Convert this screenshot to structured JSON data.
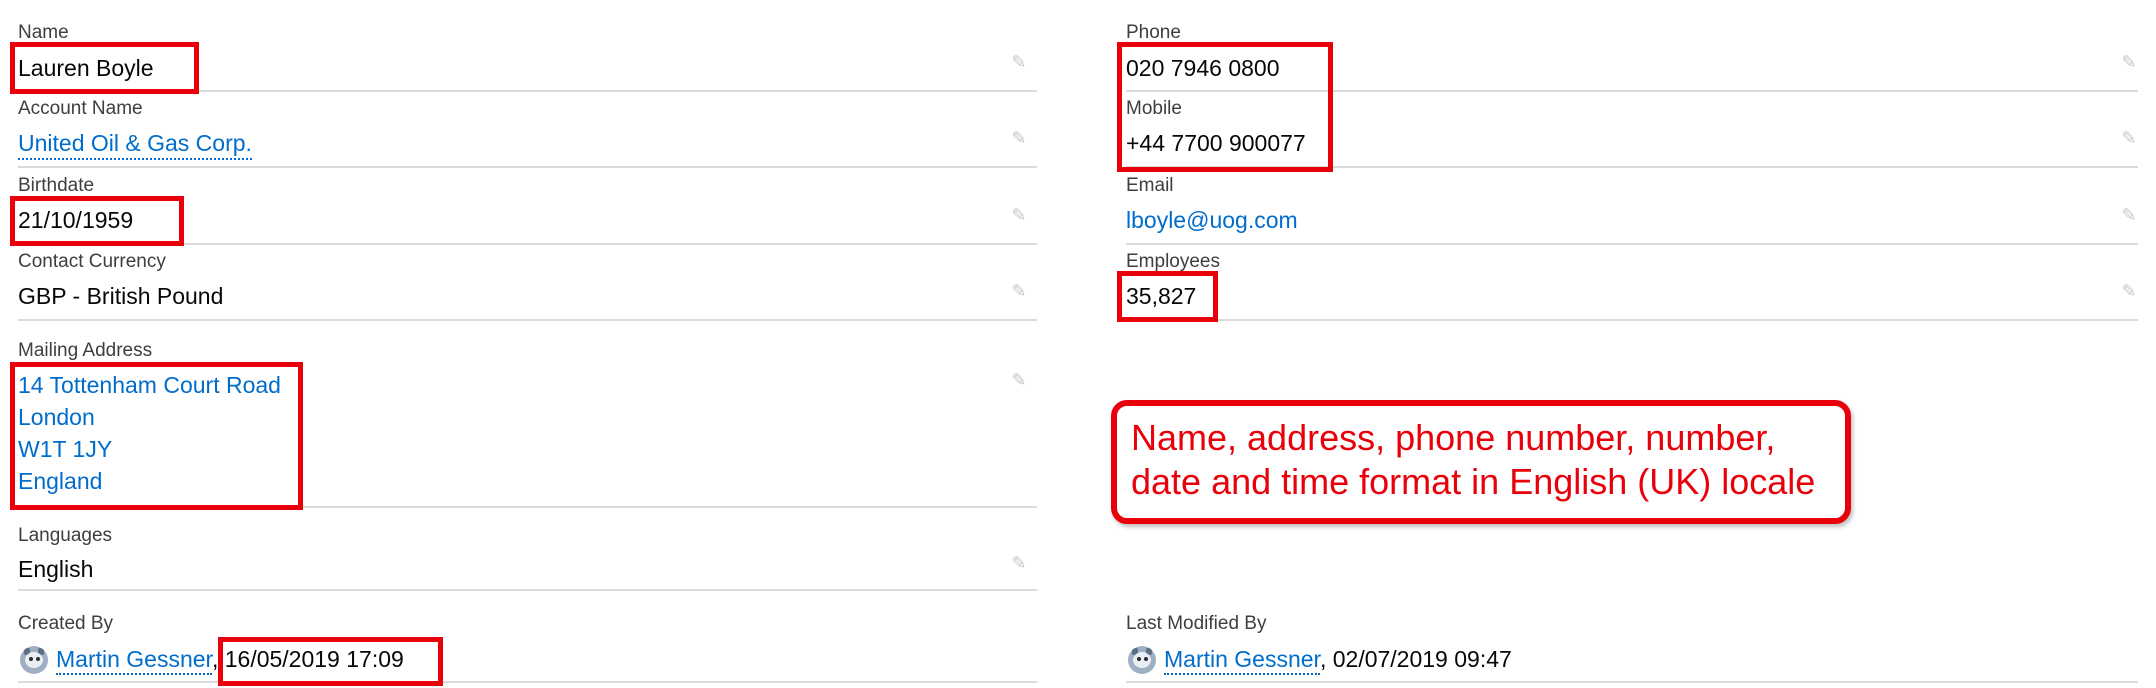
{
  "left_fields": {
    "name": {
      "label": "Name",
      "value": "Lauren Boyle"
    },
    "account_name": {
      "label": "Account Name",
      "value": "United Oil & Gas Corp."
    },
    "birthdate": {
      "label": "Birthdate",
      "value": "21/10/1959"
    },
    "contact_currency": {
      "label": "Contact Currency",
      "value": "GBP - British Pound"
    },
    "mailing_address": {
      "label": "Mailing Address",
      "lines": [
        "14 Tottenham Court Road",
        "London",
        "W1T 1JY",
        "England"
      ]
    },
    "languages": {
      "label": "Languages",
      "value": "English"
    }
  },
  "right_fields": {
    "phone": {
      "label": "Phone",
      "value": "020 7946 0800"
    },
    "mobile": {
      "label": "Mobile",
      "value": "+44 7700 900077"
    },
    "email": {
      "label": "Email",
      "value": "lboyle@uog.com"
    },
    "employees": {
      "label": "Employees",
      "value": "35,827"
    }
  },
  "created_by": {
    "label": "Created By",
    "user": "Martin Gessner",
    "separator": ",",
    "datetime": "16/05/2019 17:09"
  },
  "last_modified_by": {
    "label": "Last Modified By",
    "user": "Martin Gessner",
    "separator": ",",
    "datetime": "02/07/2019 09:47"
  },
  "callout": {
    "line1": "Name, address, phone number, number,",
    "line2": "date and time format in English (UK) locale"
  },
  "icons": {
    "edit": "pencil-icon",
    "user": "avatar-icon"
  },
  "colors": {
    "link": "#006dcc",
    "annotation": "#e8000a",
    "divider": "#dddbda",
    "label": "#3e3e3c"
  }
}
